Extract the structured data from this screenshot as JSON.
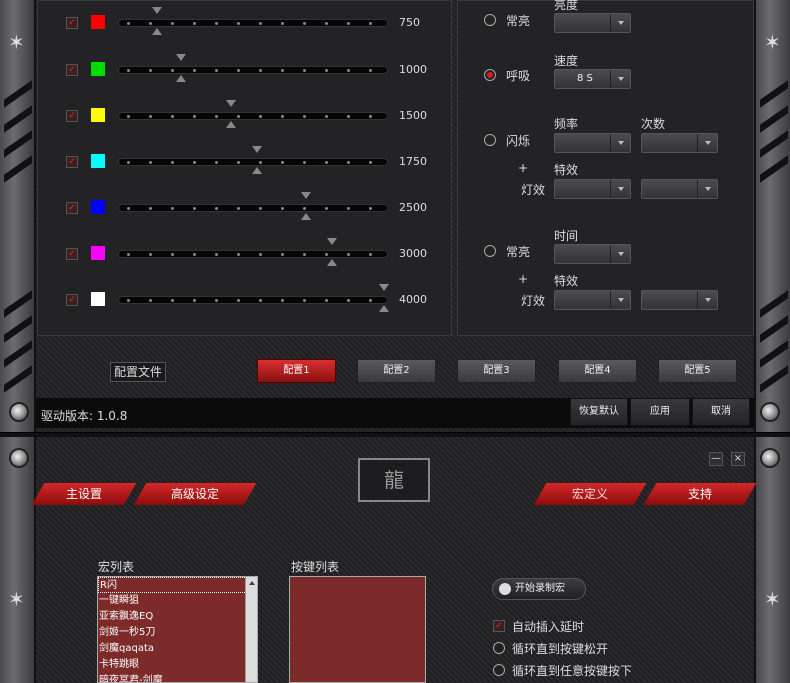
{
  "leds": [
    {
      "color": "#ff0000",
      "value": "750",
      "level": 0.125
    },
    {
      "color": "#00dd00",
      "value": "1000",
      "level": 0.22
    },
    {
      "color": "#ffff00",
      "value": "1500",
      "level": 0.41
    },
    {
      "color": "#00ffff",
      "value": "1750",
      "level": 0.51
    },
    {
      "color": "#0000ff",
      "value": "2500",
      "level": 0.7
    },
    {
      "color": "#ff00ff",
      "value": "3000",
      "level": 0.8
    },
    {
      "color": "#ffffff",
      "value": "4000",
      "level": 1.0
    }
  ],
  "modes": {
    "brightness_label": "亮度",
    "steady": "常亮",
    "speed_label": "速度",
    "breathing": "呼吸",
    "speed_value": "8 S",
    "freq_label": "频率",
    "count_label": "次数",
    "flash": "闪烁",
    "plus": "+",
    "effect_label": "特效",
    "light_effect": "灯效",
    "time_label": "时间",
    "steady2": "常亮"
  },
  "profile": {
    "file_button": "配置文件",
    "buttons": [
      "配置1",
      "配置2",
      "配置3",
      "配置4",
      "配置5"
    ]
  },
  "footer": {
    "version": "驱动版本: 1.0.8",
    "restore": "恢复默认",
    "apply": "应用",
    "cancel": "取消"
  },
  "window": {
    "minimize": "—",
    "close": "×",
    "logo": "龍"
  },
  "tabs": {
    "main": "主设置",
    "advanced": "高级设定",
    "macro": "宏定义",
    "support": "支持"
  },
  "macro": {
    "list_label": "宏列表",
    "keys_label": "按键列表",
    "items": [
      "R闪",
      "一键瞬狙",
      "亚索飘逸EQ",
      "剑姬一秒5刀",
      "剑魔qaqata",
      "卡特跳眼",
      "暗夜冥君-剑魔"
    ],
    "record_button": "开始录制宏",
    "auto_delay": "自动插入延时",
    "loop_release": "循环直到按键松开",
    "loop_any": "循环直到任意按键按下"
  }
}
